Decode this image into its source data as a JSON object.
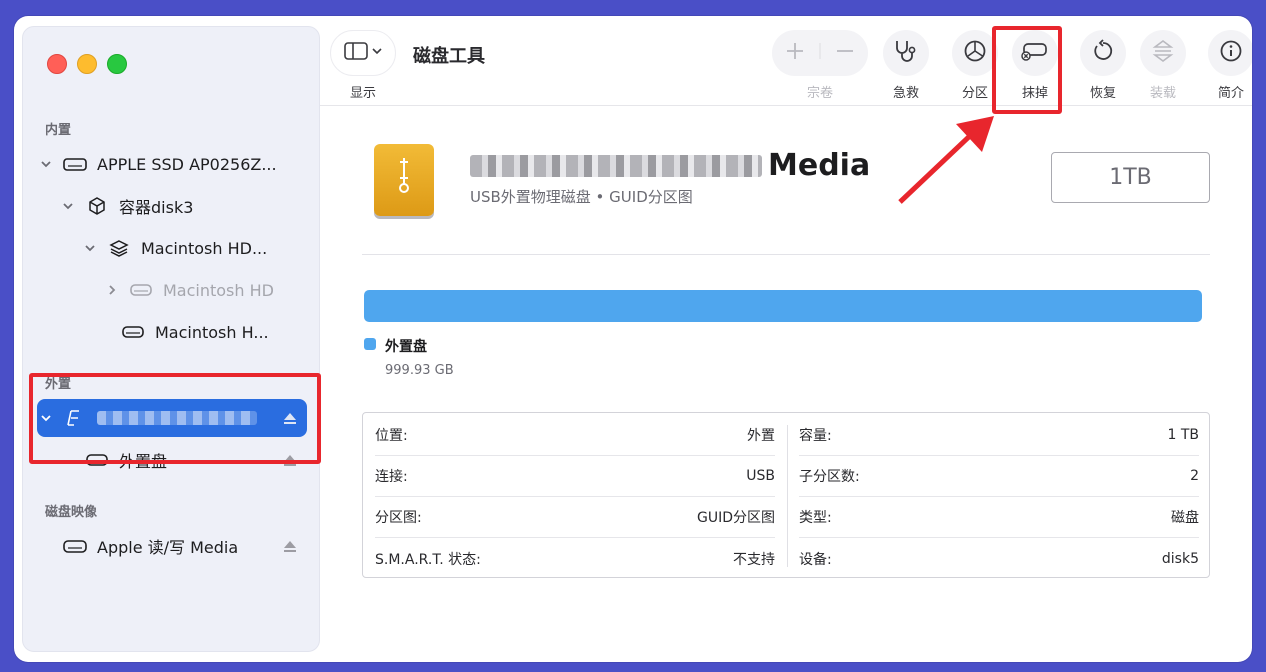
{
  "toolbar": {
    "view_label": "显示",
    "title": "磁盘工具",
    "buttons": [
      {
        "label": "宗卷",
        "icon": "plus-minus-icon",
        "enabled": false
      },
      {
        "label": "急救",
        "icon": "stethoscope-icon",
        "enabled": true
      },
      {
        "label": "分区",
        "icon": "pie-chart-icon",
        "enabled": true
      },
      {
        "label": "抹掉",
        "icon": "erase-disk-icon",
        "enabled": true
      },
      {
        "label": "恢复",
        "icon": "restore-icon",
        "enabled": true
      },
      {
        "label": "装载",
        "icon": "mount-icon",
        "enabled": false
      },
      {
        "label": "简介",
        "icon": "info-icon",
        "enabled": true
      }
    ]
  },
  "sidebar": {
    "sections": {
      "internal": "内置",
      "external": "外置",
      "images": "磁盘映像"
    },
    "internal_items": [
      {
        "label": "APPLE SSD AP0256Z...",
        "icon": "internal-disk-icon"
      },
      {
        "label": "容器disk3",
        "icon": "container-icon"
      },
      {
        "label": "Macintosh HD...",
        "icon": "layers-icon"
      },
      {
        "label": "Macintosh HD",
        "icon": "disk-icon"
      },
      {
        "label": "Macintosh H...",
        "icon": "disk-icon"
      }
    ],
    "external_items": [
      {
        "label": "",
        "icon": "usb-disk-icon",
        "selected": true
      },
      {
        "label": "外置盘",
        "icon": "disk-icon"
      }
    ],
    "image_items": [
      {
        "label": "Apple 读/写 Media",
        "icon": "disk-image-icon"
      }
    ]
  },
  "main": {
    "drive_title_suffix": "Media",
    "drive_subtitle": "USB外置物理磁盘 • GUID分区图",
    "capacity": "1TB",
    "legend_name": "外置盘",
    "legend_size": "999.93 GB",
    "usage_color": "#4fa6ee",
    "info_left": [
      {
        "key": "位置:",
        "value": "外置"
      },
      {
        "key": "连接:",
        "value": "USB"
      },
      {
        "key": "分区图:",
        "value": "GUID分区图"
      },
      {
        "key": "S.M.A.R.T. 状态:",
        "value": "不支持"
      }
    ],
    "info_right": [
      {
        "key": "容量:",
        "value": "1 TB"
      },
      {
        "key": "子分区数:",
        "value": "2"
      },
      {
        "key": "类型:",
        "value": "磁盘"
      },
      {
        "key": "设备:",
        "value": "disk5"
      }
    ]
  },
  "annotation_color": "#e8262d"
}
